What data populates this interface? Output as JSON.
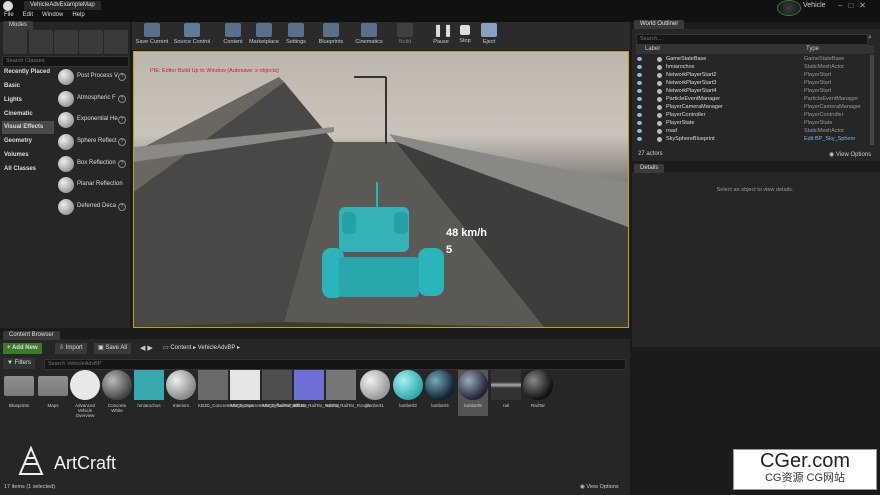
{
  "title_tab": "VehicleAdvExampleMap",
  "app_title": "Vehicle",
  "menu": [
    "File",
    "Edit",
    "Window",
    "Help"
  ],
  "modes": {
    "tab": "Modes",
    "search_placeholder": "Search Classes",
    "categories": [
      "Recently Placed",
      "Basic",
      "Lights",
      "Cinematic",
      "Visual Effects",
      "Geometry",
      "Volumes",
      "All Classes"
    ],
    "items": [
      "Post Process V",
      "Atmospheric F",
      "Exponential He",
      "Sphere Reflect",
      "Box Reflection",
      "Planar Reflection",
      "Deferred Deca"
    ]
  },
  "toolbar": [
    "Save Current",
    "Source Control",
    "Content",
    "Marketplace",
    "Settings",
    "Blueprints",
    "Cinematics",
    "Build",
    "Pause",
    "Stop",
    "Eject"
  ],
  "viewport": {
    "overlay_text": "PIE: Editor Build Up to Window (Autosave: x objects)",
    "speed": "48 km/h",
    "gear": "5"
  },
  "outliner": {
    "tab": "World Outliner",
    "search_placeholder": "Search...",
    "col_label": "Label",
    "col_type": "Type",
    "rows": [
      {
        "label": "GameStateBase",
        "type": "GameStateBase"
      },
      {
        "label": "hmiarochos",
        "type": "StaticMeshActor"
      },
      {
        "label": "NetworkPlayerStart2",
        "type": "PlayerStart"
      },
      {
        "label": "NetworkPlayerStart3",
        "type": "PlayerStart"
      },
      {
        "label": "NetworkPlayerStart4",
        "type": "PlayerStart"
      },
      {
        "label": "ParticleEventManager",
        "type": "ParticleEventManager"
      },
      {
        "label": "PlayerCameraManager",
        "type": "PlayerCameraManager"
      },
      {
        "label": "PlayerController",
        "type": "PlayerController"
      },
      {
        "label": "PlayerState",
        "type": "PlayerState"
      },
      {
        "label": "road",
        "type": "StaticMeshActor"
      },
      {
        "label": "SkySphereBlueprint",
        "type": "Edit BP_Sky_Sphere"
      }
    ],
    "count": "27 actors",
    "view_options": "View Options"
  },
  "details": {
    "tab": "Details",
    "empty": "Select an object to view details."
  },
  "content_browser": {
    "tab": "Content Browser",
    "add_new": "Add New",
    "import": "Import",
    "save_all": "Save All",
    "path": [
      "Content",
      "VehicleAdvBP"
    ],
    "filters": "Filters",
    "search_placeholder": "Search VehicleAdvBP",
    "assets": [
      "Blueprints",
      "Maps",
      "Advanced Vehicle Overview",
      "Concrete White",
      "hmiarochos",
      "Interiors",
      "KB3D_ConcreteMix_Bumps",
      "KB3D_ConcreteMix_DiffuseWhite",
      "KB3D_RailTar_Diffuse",
      "KB3D_RailTar_Normal",
      "KB3D_RailTar_Rough",
      "lambert1",
      "lambert3",
      "lambert4",
      "lambert5",
      "rail",
      "RailTar"
    ],
    "status": "17 items (1 selected)",
    "view_options": "View Options"
  },
  "watermarks": {
    "artcraft": "ArtCraft",
    "cger": "CGer.com",
    "cger_sub": "CG资源  CG网站"
  }
}
